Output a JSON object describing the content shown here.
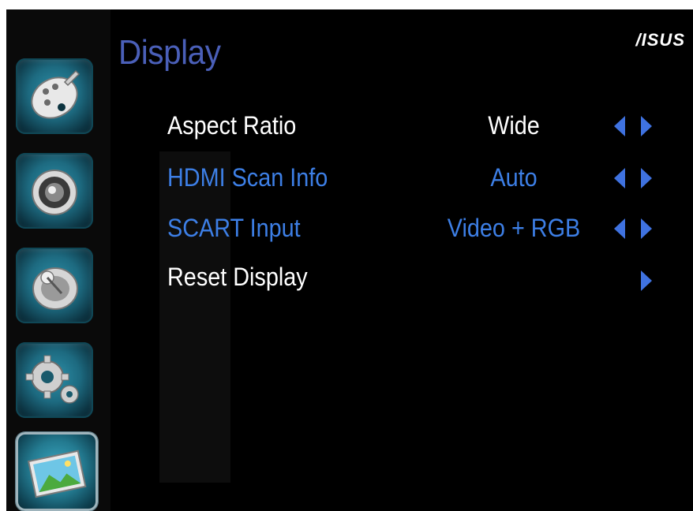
{
  "page": {
    "title": "Display",
    "brand": "/ISUS"
  },
  "sidebar": {
    "items": [
      {
        "icon": "palette-icon",
        "active": false
      },
      {
        "icon": "speaker-icon",
        "active": false
      },
      {
        "icon": "satellite-dish-icon",
        "active": false
      },
      {
        "icon": "gears-icon",
        "active": false
      },
      {
        "icon": "picture-icon",
        "active": true
      }
    ]
  },
  "menu": {
    "items": [
      {
        "label": "Aspect Ratio",
        "value": "Wide",
        "label_color": "#ffffff",
        "value_color": "#ffffff",
        "arrows": "both"
      },
      {
        "label": "HDMI Scan Info",
        "value": "Auto",
        "label_color": "#3d7fe6",
        "value_color": "#3d7fe6",
        "arrows": "both"
      },
      {
        "label": "SCART Input",
        "value": "Video + RGB",
        "label_color": "#3d7fe6",
        "value_color": "#3d7fe6",
        "arrows": "both"
      },
      {
        "label": "Reset Display",
        "value": "",
        "label_color": "#ffffff",
        "value_color": "#ffffff",
        "arrows": "right"
      }
    ]
  },
  "colors": {
    "title": "#4a5fb8",
    "arrow": "#3f72e0",
    "background": "#000000"
  }
}
